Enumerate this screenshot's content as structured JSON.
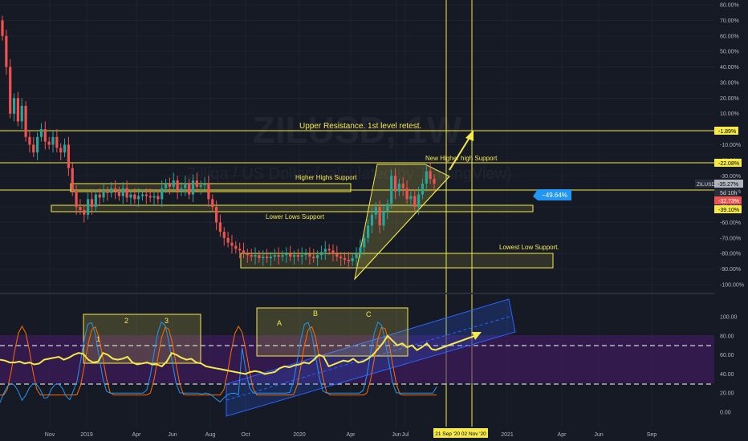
{
  "symbol": "ZILUSD",
  "watermark": {
    "title": "ZILUSD, 1W",
    "subtitle": "Zilliqa / US Dollar (calculated by TradingView)"
  },
  "price_axis_ticks": [
    "80.00%",
    "70.00%",
    "60.00%",
    "50.00%",
    "40.00%",
    "30.00%",
    "20.00%",
    "10.00%",
    "0.00%",
    "-10.00%",
    "-20.00%",
    "-30.00%",
    "-40.00%",
    "-50.00%",
    "-60.00%",
    "-70.00%",
    "-80.00%",
    "-90.00%",
    "-100.00%"
  ],
  "oscillator_ticks": [
    "100.00",
    "80.00",
    "60.00",
    "40.00",
    "20.00",
    "0.00"
  ],
  "date_ticks": [
    "Nov",
    "2019",
    "Apr",
    "Jun",
    "Aug",
    "Oct",
    "2020",
    "Apr",
    "Jun",
    "Jul",
    "2021",
    "Apr",
    "Jun",
    "Sep"
  ],
  "date_highlight": "21 Sep '20 02 Nov '20",
  "price_tags": {
    "symbol_label": "ZILUSD",
    "current": "-35.27%",
    "countdown": "5d 10h",
    "tag_level_a": "-32.73%",
    "tag_level_b": "-39.10%",
    "line_upper": "-1.89%",
    "line_second": "-22.08%",
    "measure": "−49.64%"
  },
  "annotations": {
    "upper_resistance": "Upper Resistance. 1st level retest.",
    "new_higher_high": "New Higher high Support",
    "higher_highs": "Higher Highs Support",
    "lower_lows": "Lower Lows Support",
    "lowest_low": "Lowest Low Support.",
    "osc_labels": [
      "1",
      "2",
      "3",
      "A",
      "B",
      "C"
    ]
  },
  "colors": {
    "background": "#161a25",
    "up_candle": "#26a69a",
    "down_candle": "#ef5350",
    "drawing": "#f5e94b",
    "oscillator_band": "#4a1c6e",
    "channel": "#2962ff",
    "stoch_k": "#2196f3",
    "stoch_d": "#ff6d00"
  },
  "chart_data": {
    "type": "candlestick",
    "y_unit": "percent change",
    "ylim": [
      -100,
      80
    ],
    "candles_close": [
      60,
      40,
      10,
      20,
      5,
      15,
      -5,
      -10,
      -15,
      -5,
      0,
      -8,
      -10,
      -5,
      -12,
      -15,
      -10,
      -25,
      -40,
      -50,
      -52,
      -55,
      -45,
      -50,
      -42,
      -44,
      -40,
      -41,
      -38,
      -40,
      -43,
      -38,
      -44,
      -42,
      -45,
      -43,
      -42,
      -43,
      -44,
      -43,
      -45,
      -38,
      -35,
      -37,
      -33,
      -40,
      -38,
      -35,
      -42,
      -33,
      -37,
      -36,
      -35,
      -45,
      -50,
      -60,
      -66,
      -70,
      -73,
      -75,
      -77,
      -78,
      -80,
      -81,
      -82,
      -81,
      -83,
      -82,
      -83,
      -82,
      -81,
      -82,
      -81,
      -80,
      -82,
      -81,
      -82,
      -81,
      -80,
      -82,
      -83,
      -81,
      -79,
      -77,
      -78,
      -80,
      -82,
      -83,
      -84,
      -85,
      -83,
      -80,
      -76,
      -70,
      -62,
      -55,
      -50,
      -62,
      -53,
      -48,
      -30,
      -40,
      -35,
      -38,
      -45,
      -43,
      -50,
      -42,
      -35,
      -27,
      -32,
      -35
    ],
    "oscillator": {
      "rsi": [
        55,
        54,
        52,
        52,
        53,
        51,
        52,
        50,
        51,
        55,
        56,
        57,
        58,
        55,
        57,
        60,
        62,
        61,
        55,
        52,
        53,
        62,
        60,
        56,
        55,
        56,
        58,
        52,
        50,
        51,
        52,
        50,
        50,
        48,
        53,
        62,
        60,
        57,
        55,
        56,
        52,
        51,
        48,
        47,
        46,
        45,
        44,
        43,
        42,
        41,
        40,
        42,
        43,
        42,
        40,
        41,
        42,
        46,
        48,
        47,
        49,
        50,
        52,
        51,
        55,
        60,
        58,
        48,
        50,
        52,
        54,
        53,
        56,
        52,
        53,
        56,
        60,
        66,
        72,
        80,
        75,
        70,
        72,
        68,
        70,
        65,
        68,
        72,
        66,
        65
      ]
    }
  }
}
